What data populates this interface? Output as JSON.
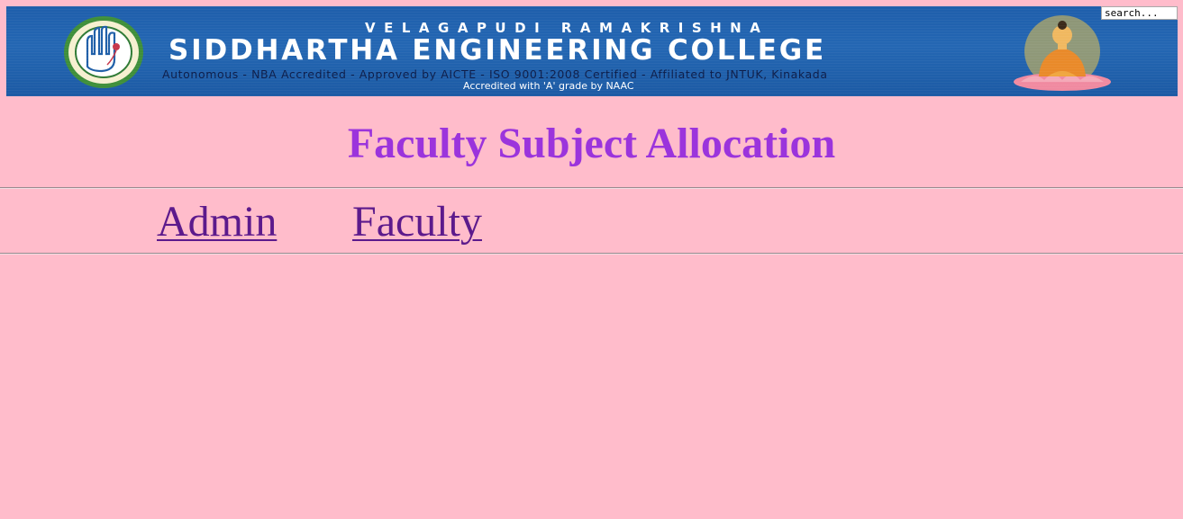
{
  "banner": {
    "line1": "VELAGAPUDI RAMAKRISHNA",
    "line2": "SIDDHARTHA ENGINEERING COLLEGE",
    "line3": "Autonomous - NBA Accredited - Approved by AICTE - ISO 9001:2008 Certified - Affiliated to JNTUK, Kinakada",
    "line4": "Accredited with 'A' grade by NAAC",
    "logo_icon": "college-emblem-icon",
    "figure_icon": "buddha-figure-icon"
  },
  "search": {
    "placeholder": "search..."
  },
  "page": {
    "title": "Faculty Subject Allocation"
  },
  "nav": {
    "admin": "Admin",
    "faculty": "Faculty"
  },
  "colors": {
    "background": "#ffbccb",
    "title": "#9b34dc",
    "link": "#5c1a8c",
    "banner": "#1e5eab"
  }
}
